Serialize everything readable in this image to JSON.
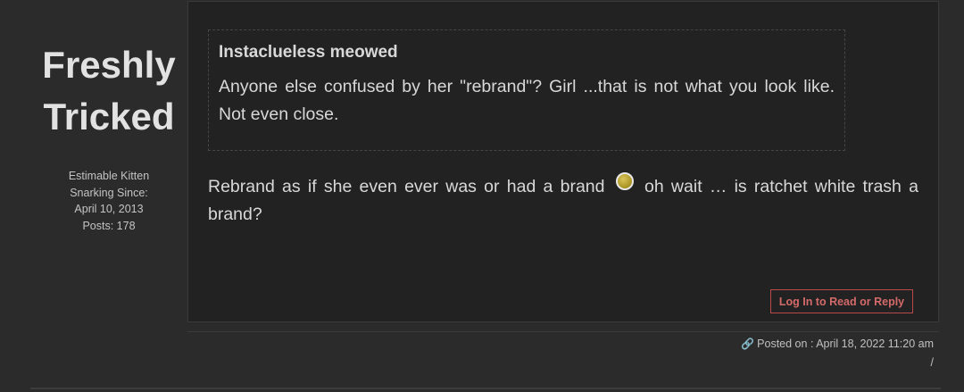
{
  "user": {
    "name_line1": "Freshly",
    "name_line2": "Tricked",
    "rank": "Estimable Kitten",
    "since_label": "Snarking Since:",
    "since_date": "April 10, 2013",
    "posts": "Posts: 178"
  },
  "quote": {
    "author": "Instaclueless meowed",
    "text": "Anyone else confused by her \"rebrand\"? Girl ...that is not what you look like. Not even close."
  },
  "post": {
    "text_before": "Rebrand as if she even ever was or had a brand",
    "emoji": "smiley-icon",
    "text_after": "oh wait … is ratchet white trash a brand?"
  },
  "actions": {
    "reply_label": "Log In to Read or Reply"
  },
  "meta": {
    "posted_on": "Posted on : April 18, 2022 11:20 am",
    "separator": "/"
  },
  "colors": {
    "background": "#2b2b2b",
    "post_background": "#222222",
    "accent": "#d46a6a"
  }
}
